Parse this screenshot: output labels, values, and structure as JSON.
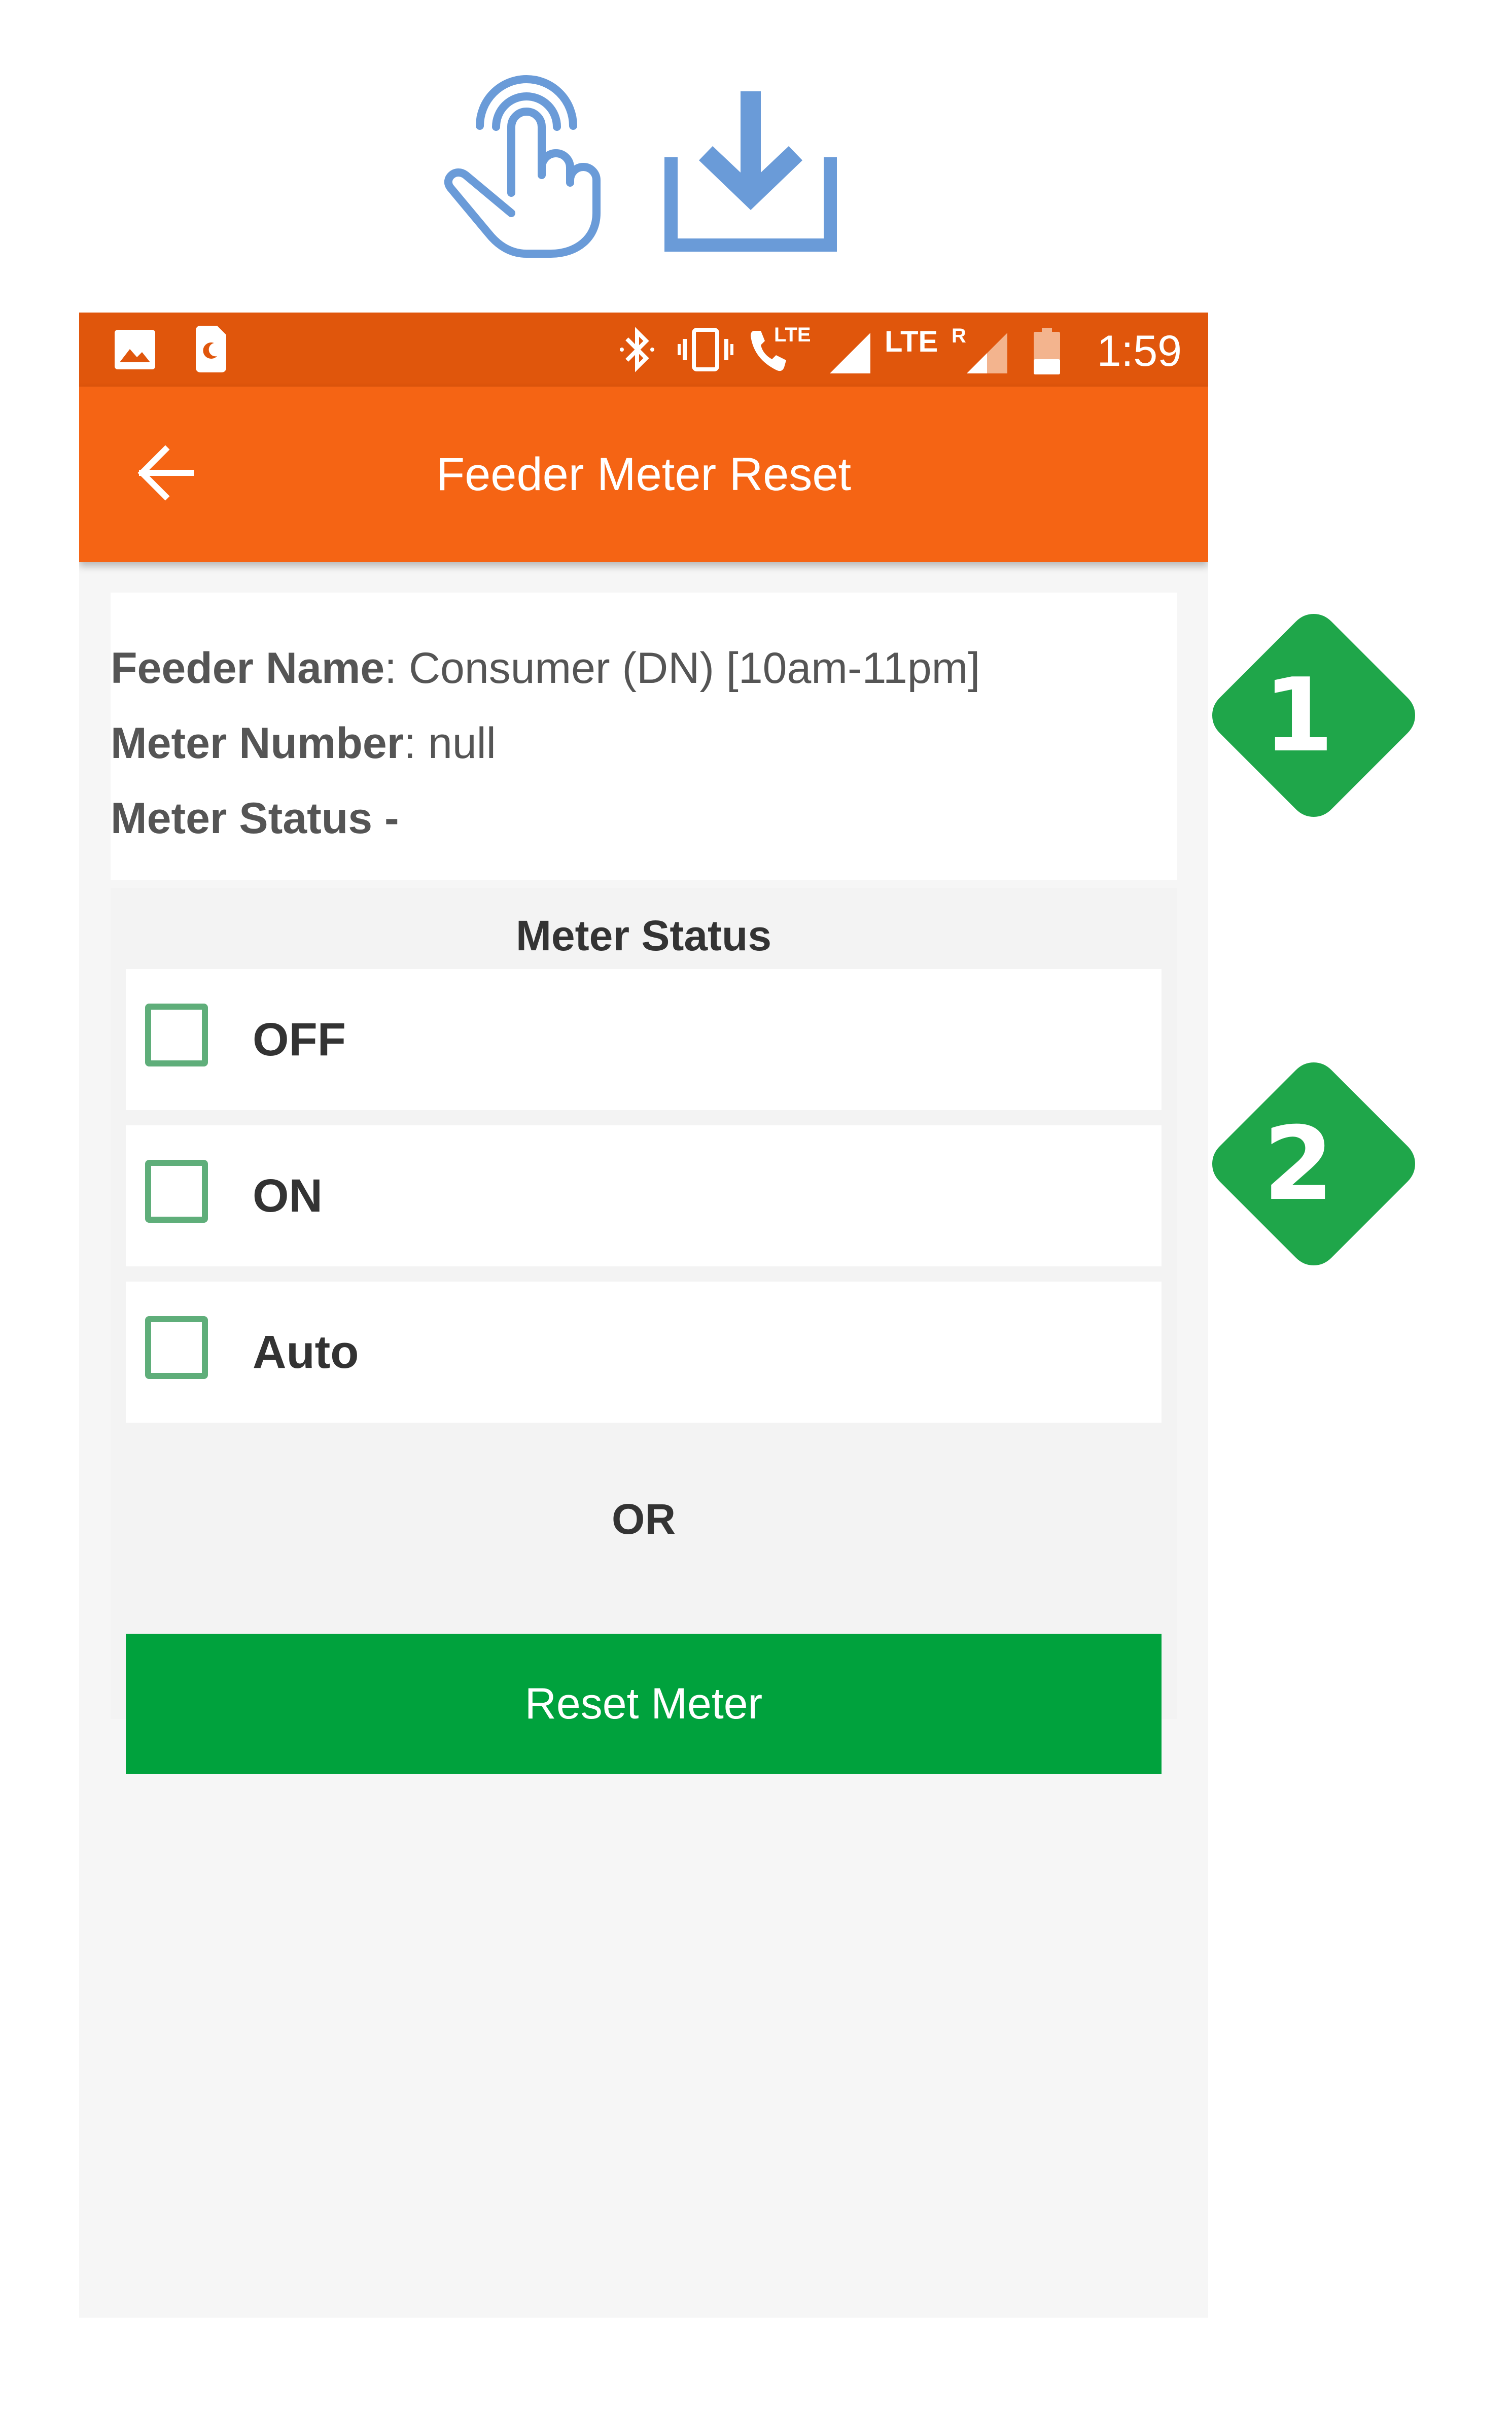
{
  "colors": {
    "status_bar": "#e0560c",
    "app_bar": "#f56414",
    "accent_green": "#00a23d",
    "checkbox_border": "#5fae7a",
    "badge_green": "#1fa64a",
    "icon_blue": "#6a9bd8"
  },
  "top_icons": [
    "tap-gesture-icon",
    "download-icon"
  ],
  "status_bar": {
    "left_icons": [
      "image-icon",
      "sim-night-icon"
    ],
    "right_icons": [
      "bluetooth-icon",
      "vibrate-icon",
      "volte-call-icon",
      "signal-icon",
      "signal-roaming-icon",
      "battery-low-icon"
    ],
    "lte_label_1": "LTE",
    "lte_label_2": "LTE",
    "roaming_label": "R",
    "time": "1:59"
  },
  "app_bar": {
    "title": "Feeder Meter Reset",
    "back_icon": "arrow-back-icon"
  },
  "info": {
    "feeder_name_label": "Feeder Name",
    "feeder_name_value": ": Consumer (DN) [10am-11pm]",
    "meter_number_label": "Meter Number",
    "meter_number_value": ": null",
    "meter_status_label": "Meter Status -"
  },
  "meter_status": {
    "title": "Meter Status",
    "options": [
      {
        "label": "OFF",
        "checked": false
      },
      {
        "label": "ON",
        "checked": false
      },
      {
        "label": "Auto",
        "checked": false
      }
    ],
    "or_text": "OR",
    "reset_button": "Reset Meter"
  },
  "callouts": [
    "1",
    "2"
  ]
}
